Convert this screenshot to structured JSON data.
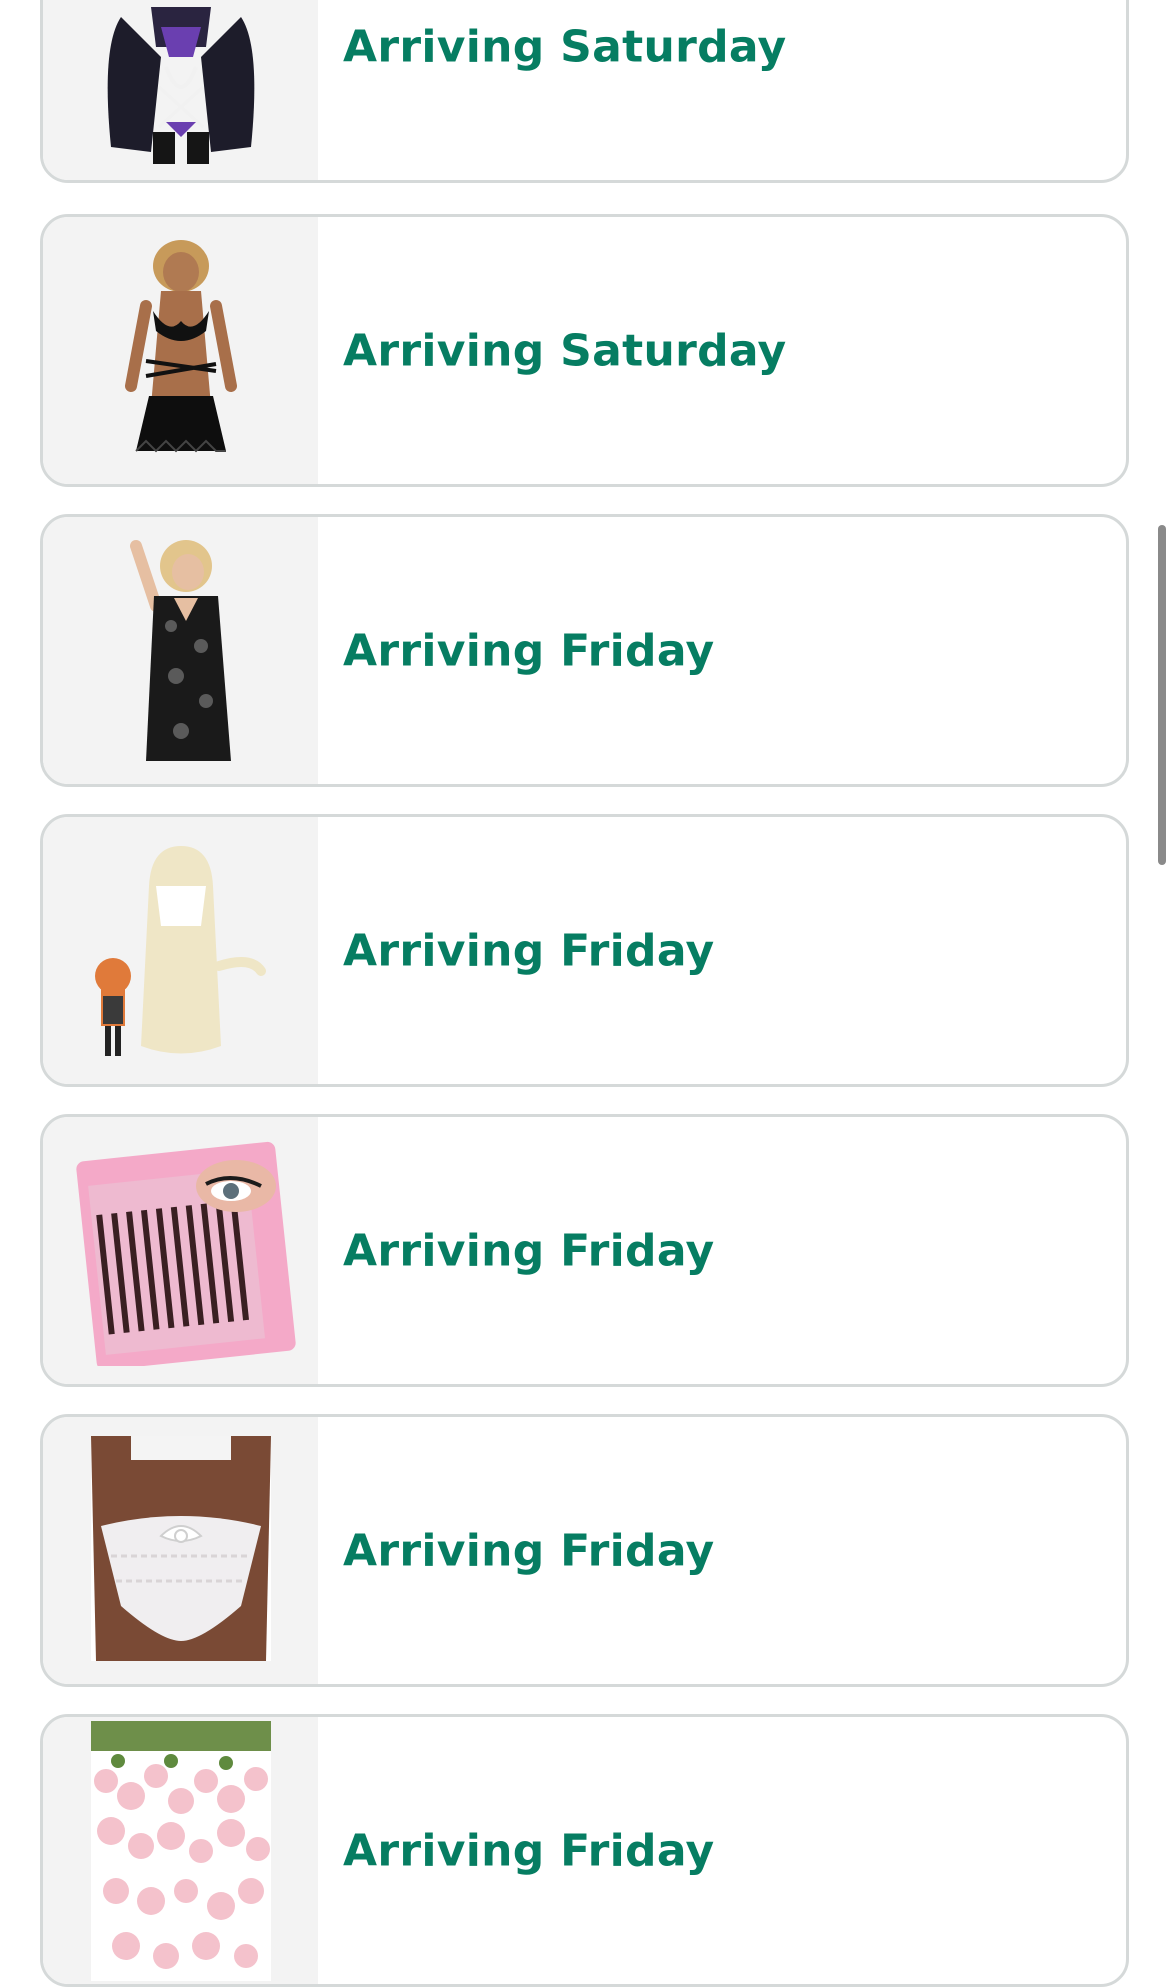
{
  "orders": [
    {
      "status": "Arriving Saturday",
      "thumbnail": "purple-black-costume-image"
    },
    {
      "status": "Arriving Saturday",
      "thumbnail": "black-strappy-set-image"
    },
    {
      "status": "Arriving Friday",
      "thumbnail": "black-lace-dress-image"
    },
    {
      "status": "Arriving Friday",
      "thumbnail": "blonde-wig-image"
    },
    {
      "status": "Arriving Friday",
      "thumbnail": "eyelash-extensions-image"
    },
    {
      "status": "Arriving Friday",
      "thumbnail": "white-lace-underwear-image"
    },
    {
      "status": "Arriving Friday",
      "thumbnail": "pink-flower-garland-image"
    }
  ],
  "colors": {
    "status_text": "#067d62",
    "card_border": "#d5d9d9",
    "thumb_background": "#f3f3f3",
    "scrollbar": "#8a8a8a"
  }
}
